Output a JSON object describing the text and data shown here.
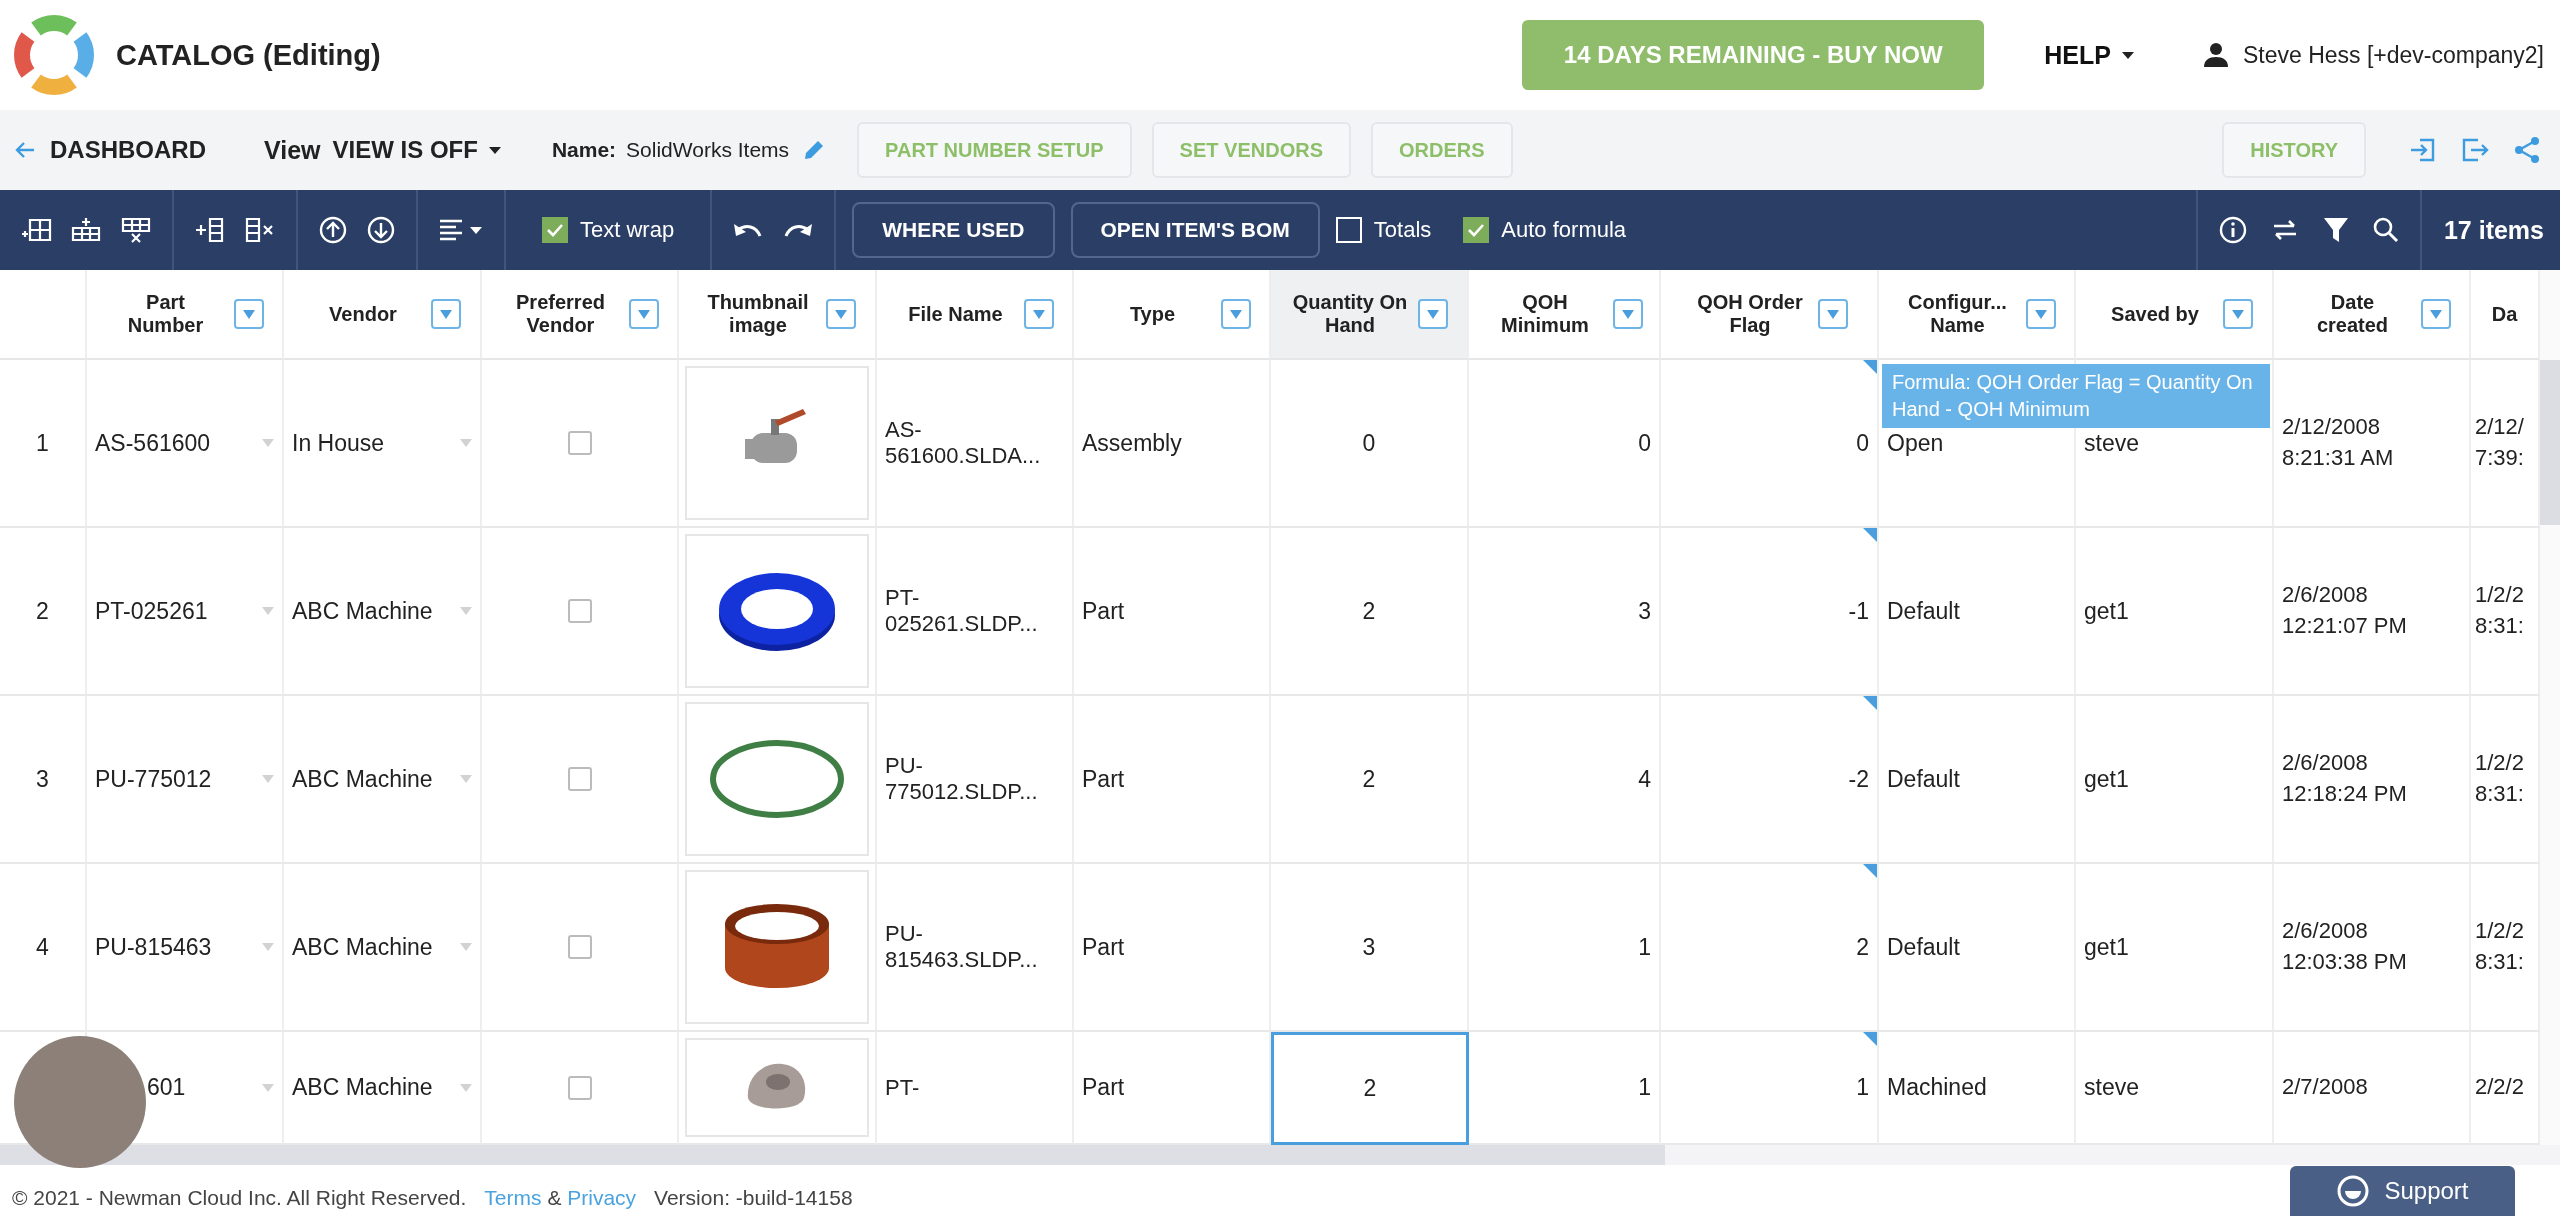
{
  "header": {
    "title": "CATALOG (Editing)",
    "trial_button": "14 DAYS REMAINING - BUY NOW",
    "help_menu": "HELP",
    "user": "Steve Hess [+dev-company2]"
  },
  "subbar": {
    "back_link": "DASHBOARD",
    "view_label": "View",
    "view_value": "VIEW IS OFF",
    "name_label": "Name:",
    "name_value": "SolidWorks Items",
    "buttons": [
      "PART NUMBER SETUP",
      "SET VENDORS",
      "ORDERS"
    ],
    "history_button": "HISTORY"
  },
  "toolbar": {
    "text_wrap": {
      "label": "Text wrap",
      "checked": true
    },
    "buttons": [
      "WHERE USED",
      "OPEN ITEM'S BOM"
    ],
    "toggles": [
      {
        "label": "Totals",
        "checked": false
      },
      {
        "label": "Auto formula",
        "checked": true
      }
    ],
    "item_count": "17 items"
  },
  "table": {
    "columns": [
      {
        "label": "Part Number",
        "highlighted": false,
        "filter_button": true
      },
      {
        "label": "Vendor",
        "highlighted": false,
        "filter_button": true
      },
      {
        "label": "Preferred Vendor",
        "highlighted": false,
        "filter_button": true
      },
      {
        "label": "Thumbnail image",
        "highlighted": false,
        "filter_button": true
      },
      {
        "label": "File Name",
        "highlighted": false,
        "filter_button": true
      },
      {
        "label": "Type",
        "highlighted": false,
        "filter_button": true
      },
      {
        "label": "Quantity On Hand",
        "highlighted": true,
        "filter_button": true
      },
      {
        "label": "QOH Minimum",
        "highlighted": false,
        "filter_button": true
      },
      {
        "label": "QOH Order Flag",
        "highlighted": false,
        "filter_button": true
      },
      {
        "label": "Configur... Name",
        "highlighted": false,
        "filter_button": true
      },
      {
        "label": "Saved by",
        "highlighted": false,
        "filter_button": true
      },
      {
        "label": "Date created",
        "highlighted": false,
        "filter_button": true
      },
      {
        "label": "Da",
        "highlighted": false,
        "filter_button": false
      }
    ],
    "rows": [
      {
        "number": "1",
        "part_number": "AS-561600",
        "vendor": "In House",
        "preferred_vendor": false,
        "thumbnail": {
          "kind": "valve",
          "color": "#9a9a9a"
        },
        "file_name": "AS-561600.SLDA...",
        "type": "Assembly",
        "quantity_on_hand": "0",
        "qoh_minimum": "0",
        "qoh_order_flag": "0",
        "configuration_name": "Open",
        "saved_by": "steve",
        "date_created": "2/12/2008\n8:21:31 AM",
        "column_13": "2/12/\n7:39:",
        "qty_cell_selected": false
      },
      {
        "number": "2",
        "part_number": "PT-025261",
        "vendor": "ABC Machine",
        "preferred_vendor": false,
        "thumbnail": {
          "kind": "ring",
          "color": "#1535d8"
        },
        "file_name": "PT-025261.SLDP...",
        "type": "Part",
        "quantity_on_hand": "2",
        "qoh_minimum": "3",
        "qoh_order_flag": "-1",
        "configuration_name": "Default",
        "saved_by": "get1",
        "date_created": "2/6/2008\n12:21:07 PM",
        "column_13": "1/2/2\n8:31:",
        "qty_cell_selected": false
      },
      {
        "number": "3",
        "part_number": "PU-775012",
        "vendor": "ABC Machine",
        "preferred_vendor": false,
        "thumbnail": {
          "kind": "hoop",
          "color": "#3f7f45"
        },
        "file_name": "PU-775012.SLDP...",
        "type": "Part",
        "quantity_on_hand": "2",
        "qoh_minimum": "4",
        "qoh_order_flag": "-2",
        "configuration_name": "Default",
        "saved_by": "get1",
        "date_created": "2/6/2008\n12:18:24 PM",
        "column_13": "1/2/2\n8:31:",
        "qty_cell_selected": false
      },
      {
        "number": "4",
        "part_number": "PU-815463",
        "vendor": "ABC Machine",
        "preferred_vendor": false,
        "thumbnail": {
          "kind": "band",
          "color": "#b0461c"
        },
        "file_name": "PU-815463.SLDP...",
        "type": "Part",
        "quantity_on_hand": "3",
        "qoh_minimum": "1",
        "qoh_order_flag": "2",
        "configuration_name": "Default",
        "saved_by": "get1",
        "date_created": "2/6/2008\n12:03:38 PM",
        "column_13": "1/2/2\n8:31:",
        "qty_cell_selected": false
      },
      {
        "part_number": "601",
        "vendor": "ABC Machine",
        "preferred_vendor": false,
        "thumbnail": {
          "kind": "hub",
          "color": "#a89c98"
        },
        "file_name": "PT-",
        "type": "Part",
        "quantity_on_hand": "2",
        "qoh_minimum": "1",
        "qoh_order_flag": "1",
        "configuration_name": "Machined",
        "saved_by": "steve",
        "date_created": "2/7/2008",
        "column_13": "2/2/2",
        "qty_cell_selected": true
      }
    ]
  },
  "tooltip": "Formula: QOH Order Flag = Quantity On Hand - QOH Minimum",
  "footer": {
    "copyright": "© 2021 - Newman Cloud Inc. All Right Reserved.",
    "terms_link": "Terms",
    "ampersand": "&",
    "privacy_link": "Privacy",
    "version": "Version: -build-14158"
  },
  "support_button": "Support"
}
